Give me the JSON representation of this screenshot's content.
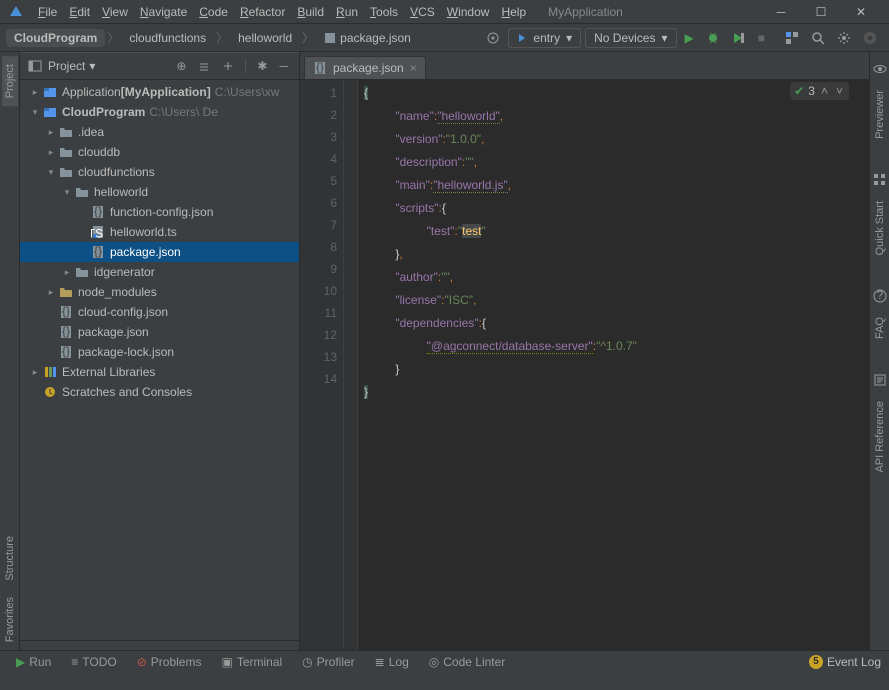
{
  "titlebar": {
    "menus": [
      "File",
      "Edit",
      "View",
      "Navigate",
      "Code",
      "Refactor",
      "Build",
      "Run",
      "Tools",
      "VCS",
      "Window",
      "Help"
    ],
    "app_title": "MyApplication"
  },
  "navbar": {
    "breadcrumbs": [
      "CloudProgram",
      "cloudfunctions",
      "helloworld",
      "package.json"
    ],
    "config_label": "entry",
    "device_label": "No Devices"
  },
  "project": {
    "title": "Project",
    "tree": [
      {
        "depth": 0,
        "arrow": "right",
        "icon": "module",
        "label": "Application",
        "bold_suffix": "[MyApplication]",
        "hint": "C:\\Users\\xw",
        "interact": true
      },
      {
        "depth": 0,
        "arrow": "down",
        "icon": "module",
        "label": "CloudProgram",
        "bold": true,
        "hint": "C:\\Users\\           De",
        "interact": true
      },
      {
        "depth": 1,
        "arrow": "right",
        "icon": "folder",
        "label": ".idea",
        "interact": true
      },
      {
        "depth": 1,
        "arrow": "right",
        "icon": "folder",
        "label": "clouddb",
        "interact": true
      },
      {
        "depth": 1,
        "arrow": "down",
        "icon": "folder",
        "label": "cloudfunctions",
        "interact": true
      },
      {
        "depth": 2,
        "arrow": "down",
        "icon": "folder",
        "label": "helloworld",
        "interact": true
      },
      {
        "depth": 3,
        "arrow": "",
        "icon": "json",
        "label": "function-config.json",
        "interact": true
      },
      {
        "depth": 3,
        "arrow": "",
        "icon": "ts",
        "label": "helloworld.ts",
        "interact": true
      },
      {
        "depth": 3,
        "arrow": "",
        "icon": "json",
        "label": "package.json",
        "interact": true,
        "selected": true
      },
      {
        "depth": 2,
        "arrow": "right",
        "icon": "folder",
        "label": "idgenerator",
        "interact": true
      },
      {
        "depth": 1,
        "arrow": "right",
        "icon": "folder-lib",
        "label": "node_modules",
        "interact": true
      },
      {
        "depth": 1,
        "arrow": "",
        "icon": "json",
        "label": "cloud-config.json",
        "interact": true
      },
      {
        "depth": 1,
        "arrow": "",
        "icon": "json",
        "label": "package.json",
        "interact": true
      },
      {
        "depth": 1,
        "arrow": "",
        "icon": "json",
        "label": "package-lock.json",
        "interact": true
      },
      {
        "depth": 0,
        "arrow": "right",
        "icon": "lib",
        "label": "External Libraries",
        "interact": true
      },
      {
        "depth": 0,
        "arrow": "",
        "icon": "scratch",
        "label": "Scratches and Consoles",
        "interact": true
      }
    ]
  },
  "left_tabs": [
    "Project",
    "Structure",
    "Favorites"
  ],
  "right_tabs": [
    "Previewer",
    "Quick Start",
    "FAQ",
    "API Reference"
  ],
  "editor": {
    "tab_label": "package.json",
    "inspection_count": "3",
    "line_numbers": [
      "1",
      "2",
      "3",
      "4",
      "5",
      "6",
      "7",
      "8",
      "9",
      "10",
      "11",
      "12",
      "13",
      "14"
    ]
  },
  "json_content": {
    "l2_key": "\"name\"",
    "l2_val": "\"helloworld\"",
    "l3_key": "\"version\"",
    "l3_val": "\"1.0.0\"",
    "l4_key": "\"description\"",
    "l4_val": "\"\"",
    "l5_key": "\"main\"",
    "l5_val": "\"helloworld.js\"",
    "l6_key": "\"scripts\"",
    "l7_key": "\"test\"",
    "l7_val": "\"test\"",
    "l9_key": "\"author\"",
    "l9_val": "\"\"",
    "l10_key": "\"license\"",
    "l10_val": "\"ISC\"",
    "l11_key": "\"dependencies\"",
    "l12_key": "\"@agconnect/database-server\"",
    "l12_val": "\"^1.0.7\""
  },
  "bottombar": {
    "tabs": [
      "Run",
      "TODO",
      "Problems",
      "Terminal",
      "Profiler",
      "Log",
      "Code Linter"
    ],
    "event_log": "Event Log",
    "event_badge": "5"
  }
}
